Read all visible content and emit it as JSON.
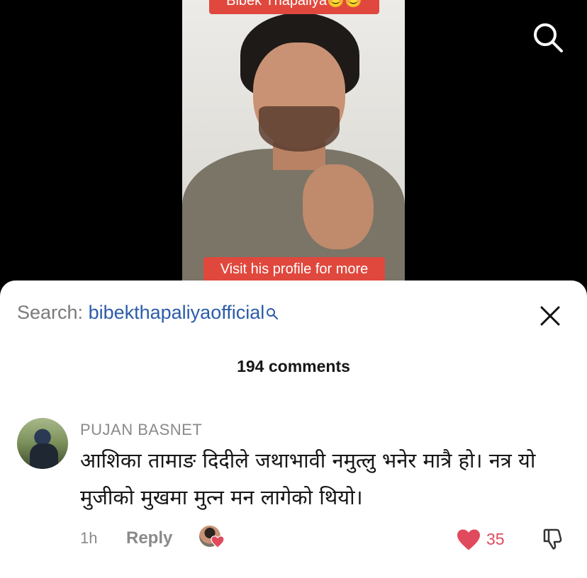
{
  "video": {
    "top_caption": "Bibek Thapaliya😊😊",
    "bottom_caption": "Visit his profile for more"
  },
  "search_button": {
    "icon": "search-icon"
  },
  "sheet": {
    "search_prefix": "Search: ",
    "search_term": "bibekthapaliyaofficial",
    "close_icon": "close-icon",
    "comments_count": "194 comments"
  },
  "comment": {
    "username": "PUJAN BASNET",
    "text": "आशिका तामाङ दिदीले जथाभावी नमुत्लु भनेर मात्रै हो। नत्र यो मुजीको मुखमा मुत्न मन लागेको थियो।",
    "time": "1h",
    "reply_label": "Reply",
    "likes": "35",
    "colors": {
      "like": "#e04a5c",
      "search_term": "#2b5ca8"
    }
  }
}
